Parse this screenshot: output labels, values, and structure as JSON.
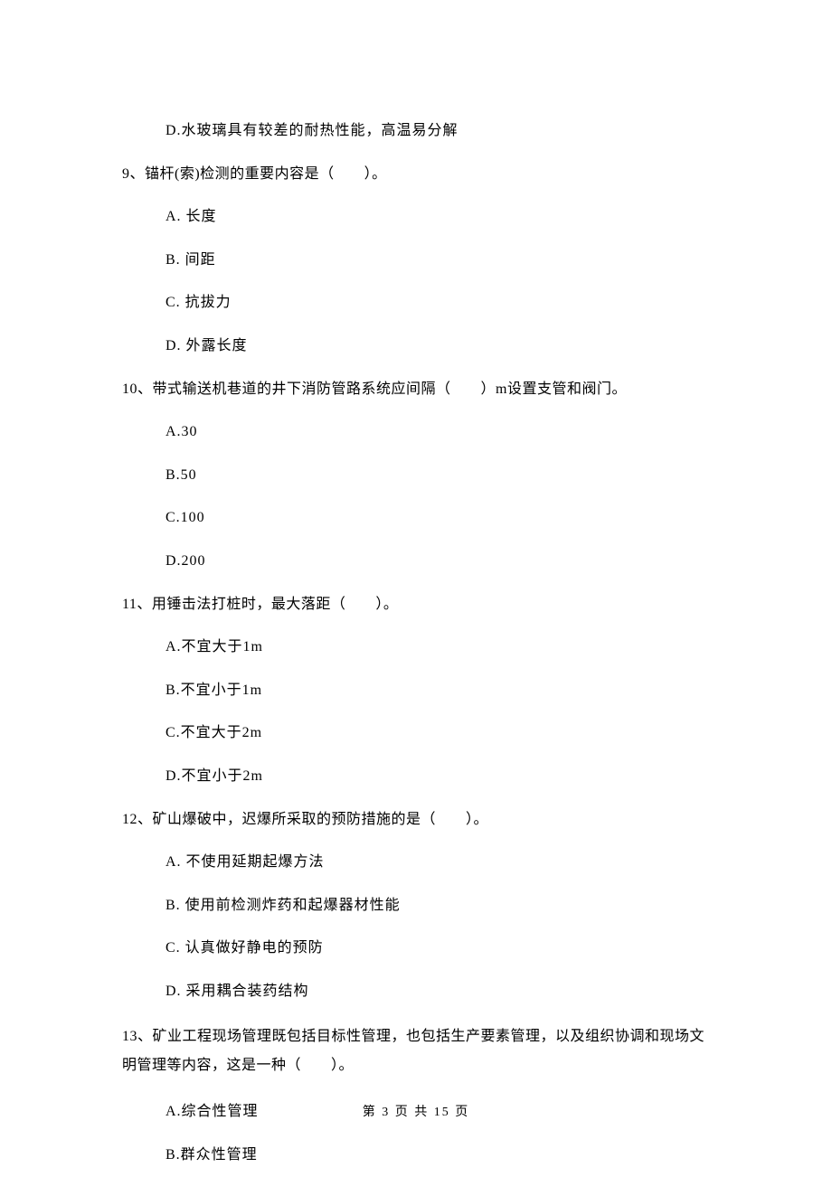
{
  "options_pre": {
    "d": "D.水玻璃具有较差的耐热性能，高温易分解"
  },
  "q9": {
    "stem": "9、锚杆(索)检测的重要内容是（　　）。",
    "a": "A. 长度",
    "b": "B. 间距",
    "c": "C. 抗拔力",
    "d": "D. 外露长度"
  },
  "q10": {
    "stem": "10、带式输送机巷道的井下消防管路系统应间隔（　　）m设置支管和阀门。",
    "a": "A.30",
    "b": "B.50",
    "c": "C.100",
    "d": "D.200"
  },
  "q11": {
    "stem": "11、用锤击法打桩时，最大落距（　　）。",
    "a": "A.不宜大于1m",
    "b": "B.不宜小于1m",
    "c": "C.不宜大于2m",
    "d": "D.不宜小于2m"
  },
  "q12": {
    "stem": "12、矿山爆破中，迟爆所采取的预防措施的是（　　）。",
    "a": "A. 不使用延期起爆方法",
    "b": "B. 使用前检测炸药和起爆器材性能",
    "c": "C. 认真做好静电的预防",
    "d": "D. 采用耦合装药结构"
  },
  "q13": {
    "stem": "13、矿业工程现场管理既包括目标性管理，也包括生产要素管理，以及组织协调和现场文明管理等内容，这是一种（　　）。",
    "a": "A.综合性管理",
    "b": "B.群众性管理"
  },
  "footer": "第 3 页 共 15 页"
}
